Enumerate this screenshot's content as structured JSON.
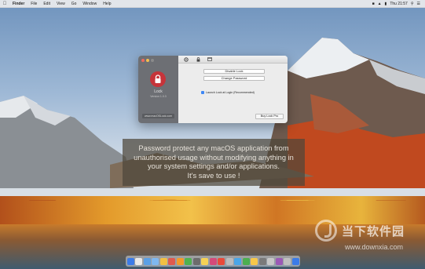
{
  "menubar": {
    "items": [
      "Finder",
      "File",
      "Edit",
      "View",
      "Go",
      "Window",
      "Help"
    ],
    "time": "Thu 21:57"
  },
  "app_window": {
    "sidebar": {
      "app_name": "Lock",
      "version": "Version 1.0.3",
      "site_link": "www.macOSLock.com"
    },
    "toolbar_icons": [
      "gear-icon",
      "lock-icon",
      "window-icon"
    ],
    "buttons": {
      "disable_lock": "Disable Lock",
      "change_password": "Change Password",
      "buy": "Buy Lock Pro"
    },
    "launch_at_login": {
      "label": "Launch Lock at Login (Recommended)",
      "checked": true
    }
  },
  "caption": {
    "line1": "Password protect any macOS application from",
    "line2": "unauthorised usage without modifying anything in",
    "line3": "your system settings and/or applications.",
    "line4": "It's save to use !"
  },
  "watermark": {
    "text": "当下软件园",
    "url": "www.downxia.com"
  },
  "dock_icon_colors": [
    "#3b7be8",
    "#e9e9e9",
    "#5aa0e6",
    "#7fb8f0",
    "#f2c043",
    "#e05a4f",
    "#f39a2a",
    "#4fb24f",
    "#6c6c6c",
    "#f6d255",
    "#d44a7a",
    "#e84a3a",
    "#bbbbbb",
    "#49a6e8",
    "#4caf50",
    "#f7c84a",
    "#7a7a7a",
    "#c7c7c7",
    "#9b59b6",
    "#bfbfbf",
    "#3b7be8"
  ]
}
